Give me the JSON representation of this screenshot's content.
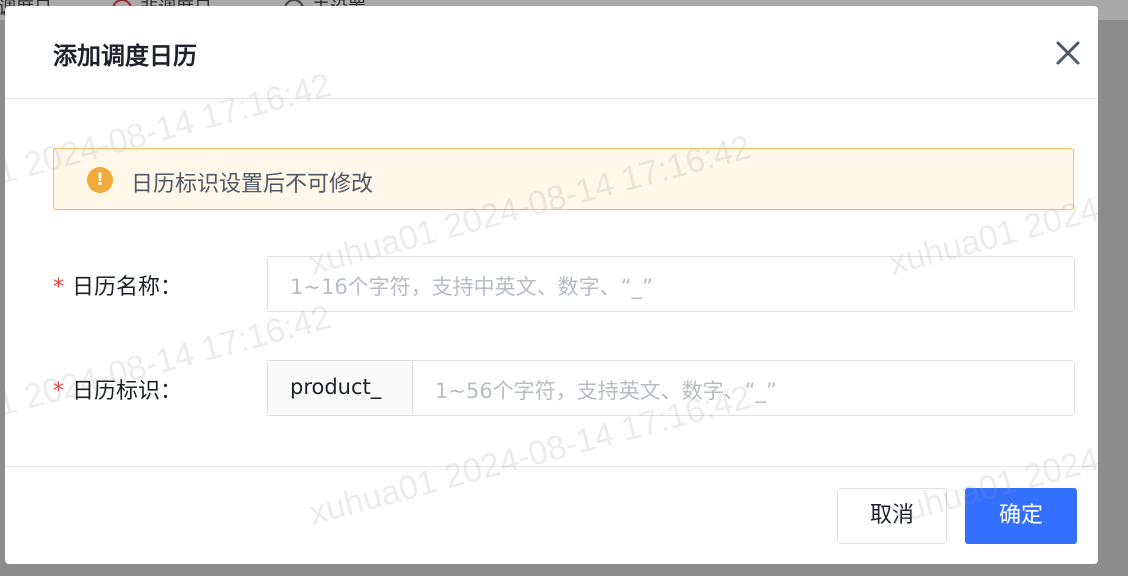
{
  "background": {
    "tabs": [
      {
        "label": "调度日"
      },
      {
        "label": "非调度日"
      },
      {
        "label": "未设置"
      }
    ]
  },
  "modal": {
    "title": "添加调度日历",
    "close_icon": "close-icon"
  },
  "alert": {
    "icon": "warning-icon",
    "text": "日历标识设置后不可修改"
  },
  "form": {
    "name": {
      "required_mark": "*",
      "label": "日历名称：",
      "placeholder": "1~16个字符，支持中英文、数字、“_”"
    },
    "identifier": {
      "required_mark": "*",
      "label": "日历标识：",
      "prefix": "product_",
      "placeholder": "1~56个字符，支持英文、数字、“_”"
    }
  },
  "footer": {
    "cancel_label": "取消",
    "ok_label": "确定"
  },
  "watermark": {
    "text": "xuhua01 2024-08-14 17:16:42"
  },
  "colors": {
    "primary": "#3370ff",
    "warning": "#f2a93b",
    "required": "#f53f3f"
  }
}
